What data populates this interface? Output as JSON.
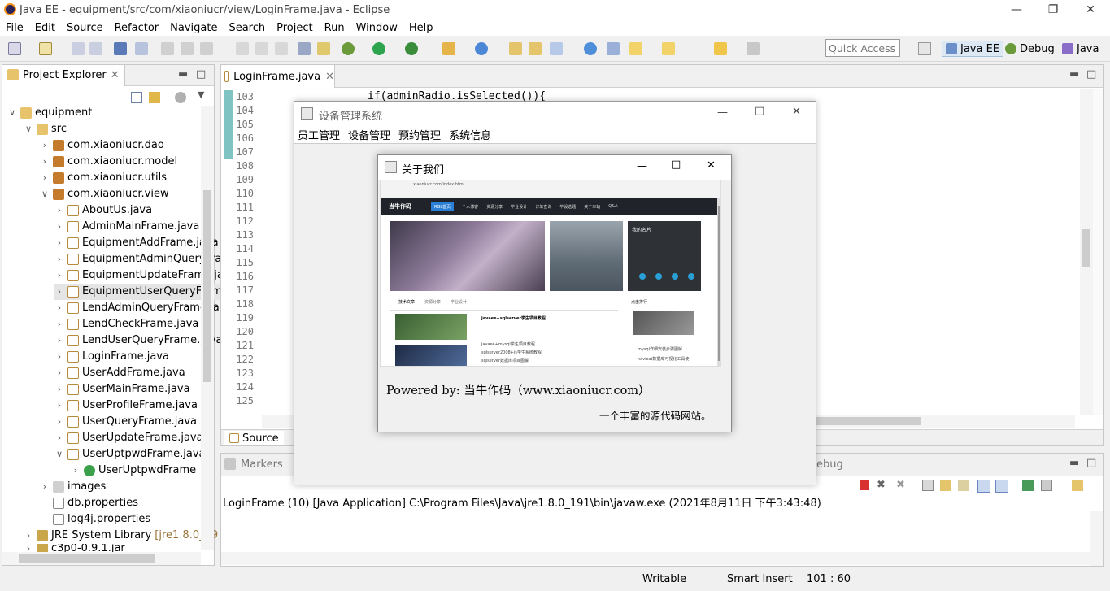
{
  "window": {
    "title": "Java EE - equipment/src/com/xiaoniucr/view/LoginFrame.java - Eclipse"
  },
  "menu": [
    "File",
    "Edit",
    "Source",
    "Refactor",
    "Navigate",
    "Search",
    "Project",
    "Run",
    "Window",
    "Help"
  ],
  "quick_access": {
    "placeholder": "Quick Access"
  },
  "perspectives": {
    "javaee": "Java EE",
    "debug": "Debug",
    "java": "Java"
  },
  "explorer": {
    "tab": "Project Explorer",
    "project": "equipment",
    "src": "src",
    "packages": [
      "com.xiaoniucr.dao",
      "com.xiaoniucr.model",
      "com.xiaoniucr.utils",
      "com.xiaoniucr.view"
    ],
    "files": [
      "AboutUs.java",
      "AdminMainFrame.java",
      "EquipmentAddFrame.java",
      "EquipmentAdminQueryFrame.java",
      "EquipmentUpdateFrame.java",
      "EquipmentUserQueryFrame.java",
      "LendAdminQueryFrame.java",
      "LendCheckFrame.java",
      "LendUserQueryFrame.java",
      "LoginFrame.java",
      "UserAddFrame.java",
      "UserMainFrame.java",
      "UserProfileFrame.java",
      "UserQueryFrame.java",
      "UserUpdateFrame.java",
      "UserUptpwdFrame.java"
    ],
    "subclass": "UserUptpwdFrame",
    "images": "images",
    "db": "db.properties",
    "log4j": "log4j.properties",
    "jre": "JRE System Library",
    "jre_version": "[jre1.8.0_19",
    "jar": "c3p0-0.9.1.jar"
  },
  "editor": {
    "tab": "LoginFrame.java",
    "lines": [
      "103",
      "104",
      "105",
      "106",
      "107",
      "108",
      "109",
      "110",
      "111",
      "112",
      "113",
      "114",
      "115",
      "116",
      "117",
      "118",
      "119",
      "120",
      "121",
      "122",
      "123",
      "124",
      "125"
    ],
    "code_line": "if(adminRadio.isSelected()){",
    "bottom_tab": "Source"
  },
  "console": {
    "markers": "Markers",
    "debug": "Debug",
    "text": "LoginFrame (10) [Java Application] C:\\Program Files\\Java\\jre1.8.0_191\\bin\\javaw.exe (2021年8月11日 下午3:43:48)"
  },
  "status": {
    "writable": "Writable",
    "insert": "Smart Insert",
    "position": "101 : 60"
  },
  "main_frame": {
    "title": "设备管理系统",
    "menu": [
      "员工管理",
      "设备管理",
      "预约管理",
      "系统信息"
    ]
  },
  "about": {
    "title": "关于我们",
    "powered": "Powered by:   当牛作码（www.xiaoniucr.com）",
    "tagline": "一个丰富的源代码网站。",
    "site": {
      "url": "xiaoniucr.com/index.html",
      "logo": "当牛作码",
      "nav": [
        "RGL首页",
        "个人博客",
        "资源分享",
        "毕业设计",
        "订单查询",
        "毕设选题",
        "关于本站",
        "Q&A"
      ],
      "card_title": "我的名片",
      "tabs": [
        "技术文章",
        "资源分享",
        "毕业设计"
      ],
      "article_title": "javaee+sqlserver学生项目教程",
      "list": [
        "javaee+mysql学生项目教程",
        "sqlserver2008+js学生系统教程",
        "sqlserver数据库项目图解"
      ],
      "side_title": "点击排行",
      "side_list": [
        "mysql详细安装步骤图解",
        "navicat数据库可视化工具使"
      ]
    }
  }
}
